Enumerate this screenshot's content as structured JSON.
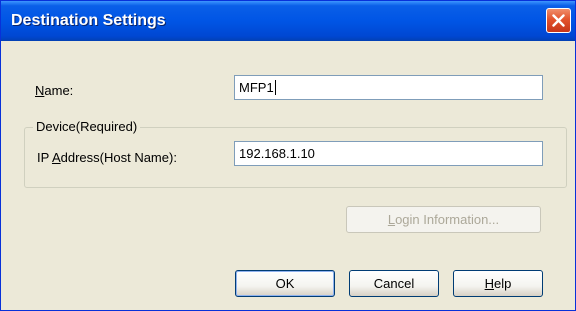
{
  "window": {
    "title": "Destination Settings",
    "close_icon": "close-x-icon",
    "colors": {
      "titlebar": "#0055e5",
      "close": "#e2532d",
      "face": "#ece9d8"
    }
  },
  "form": {
    "name": {
      "label_mnemonic": "N",
      "label_rest": "ame:",
      "value": "MFP1"
    },
    "device_group": {
      "legend": "Device(Required)"
    },
    "ip": {
      "label_before": "IP ",
      "label_mnemonic": "A",
      "label_after": "ddress(Host Name):",
      "value": "192.168.1.10"
    }
  },
  "buttons": {
    "login": {
      "mnemonic": "L",
      "rest": "ogin Information...",
      "enabled": false
    },
    "ok": {
      "label": "OK"
    },
    "cancel": {
      "label": "Cancel"
    },
    "help": {
      "mnemonic": "H",
      "rest": "elp"
    }
  }
}
